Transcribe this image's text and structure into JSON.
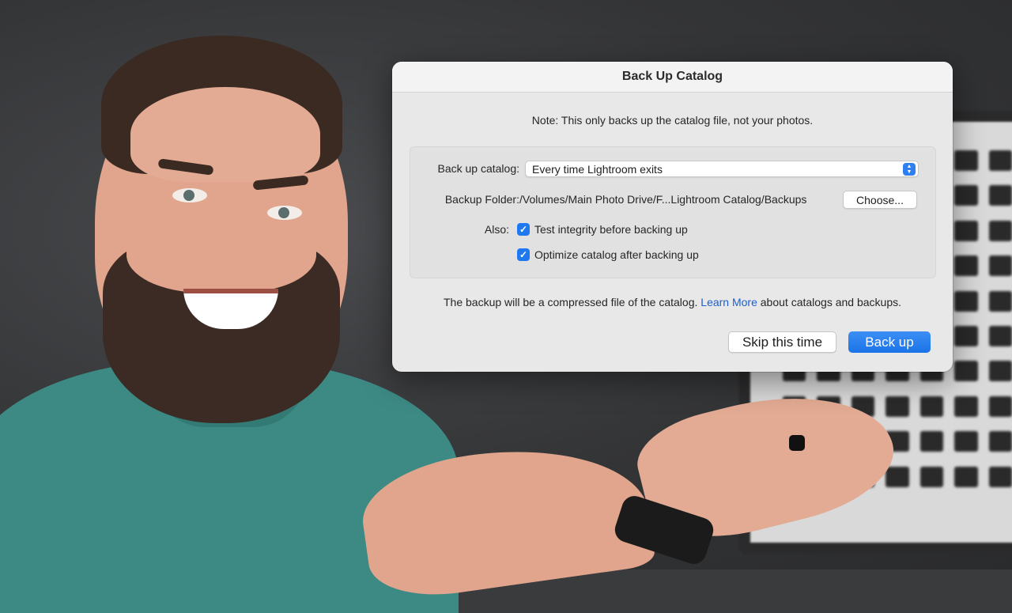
{
  "dialog": {
    "title": "Back Up Catalog",
    "note": "Note: This only backs up the catalog file, not your photos.",
    "backup_catalog_label": "Back up catalog:",
    "backup_catalog_value": "Every time Lightroom exits",
    "backup_folder_label": "Backup Folder:",
    "backup_folder_path": "/Volumes/Main Photo Drive/F...Lightroom Catalog/Backups",
    "choose_button": "Choose...",
    "also_label": "Also:",
    "options": [
      {
        "label": "Test integrity before backing up",
        "checked": true
      },
      {
        "label": "Optimize catalog after backing up",
        "checked": true
      }
    ],
    "footer_prefix": "The backup will be a compressed file of the catalog.",
    "footer_link": "Learn More",
    "footer_suffix": "about catalogs and backups.",
    "skip_button": "Skip this time",
    "backup_button": "Back up"
  },
  "colors": {
    "accent": "#1f78f0",
    "link": "#1a5fd1",
    "shirt": "#3d8a84"
  }
}
